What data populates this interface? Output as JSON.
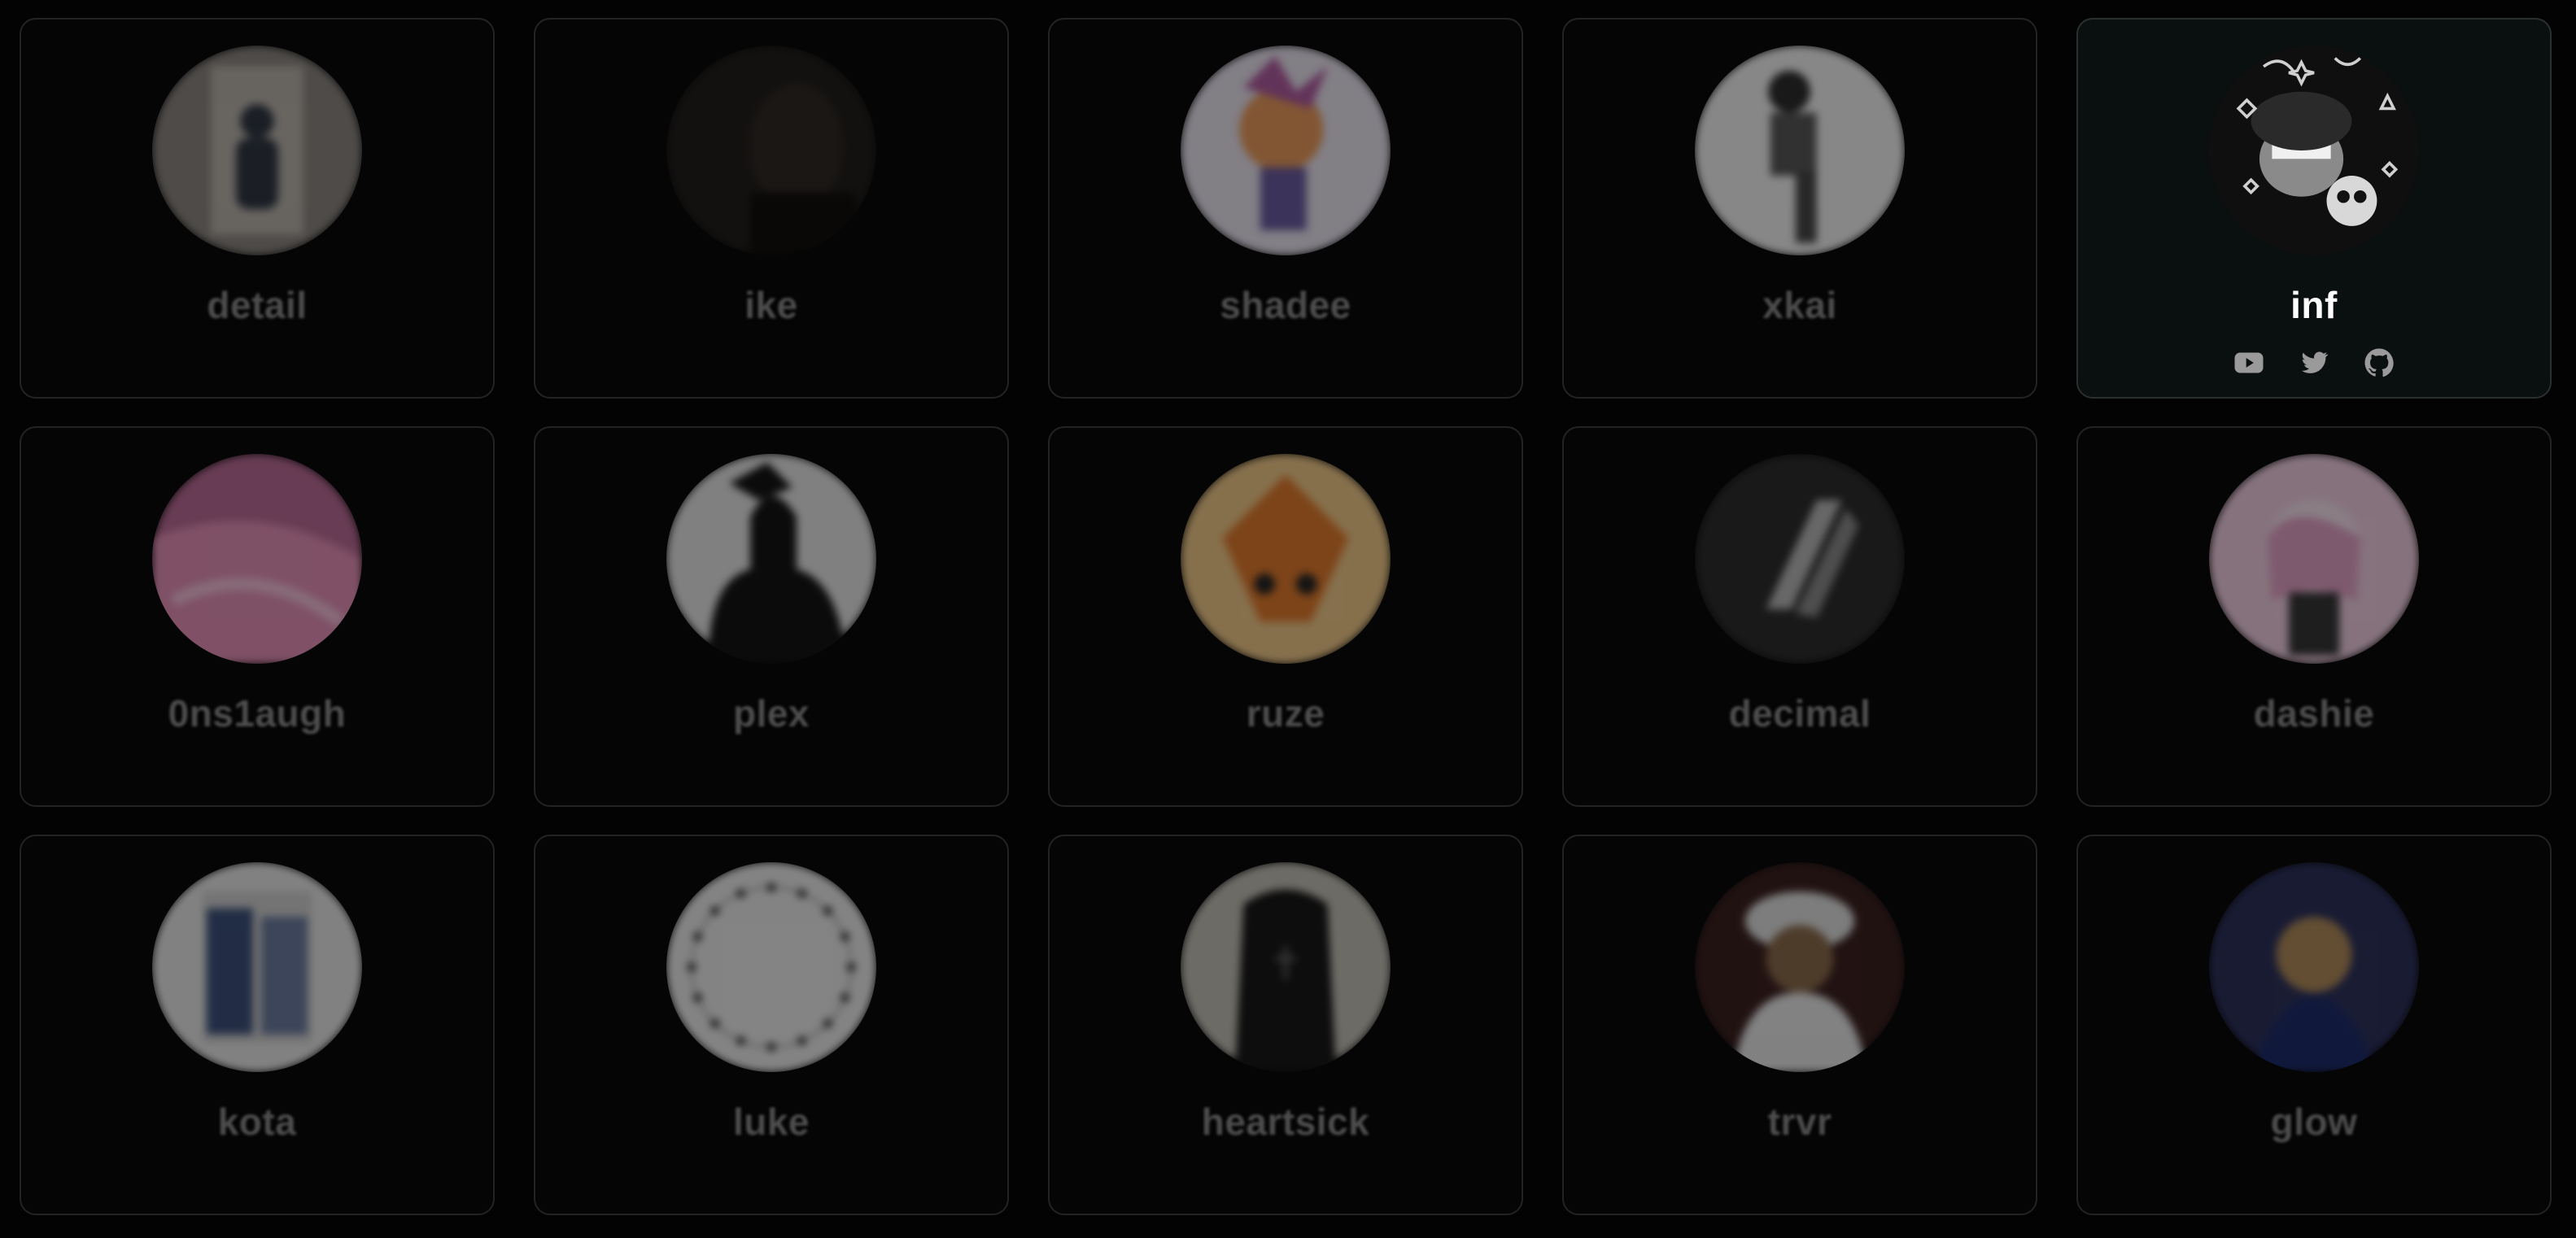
{
  "profiles": [
    {
      "name": "detail",
      "avatar": "mirror-selfie-photo",
      "bg": "#8a8580",
      "fg": "#2d3540"
    },
    {
      "name": "ike",
      "avatar": "dark-portrait-photo",
      "bg": "#1f1c1a",
      "fg": "#0d0b0a"
    },
    {
      "name": "shadee",
      "avatar": "anime-character-art",
      "bg": "#e9e3ef",
      "fg": "#b05aa0"
    },
    {
      "name": "xkai",
      "avatar": "sketch-figure-art",
      "bg": "#f2f2f2",
      "fg": "#2a2a2a"
    },
    {
      "name": "inf",
      "avatar": "doodle-character-art",
      "bg": "#1a1a1a",
      "fg": "#cfcfcf"
    },
    {
      "name": "0ns1augh",
      "avatar": "pink-abstract-art",
      "bg": "#b96a95",
      "fg": "#e48fb6"
    },
    {
      "name": "plex",
      "avatar": "black-silhouette-art",
      "bg": "#e5e5e5",
      "fg": "#111111"
    },
    {
      "name": "ruze",
      "avatar": "fox-character-art",
      "bg": "#f0c888",
      "fg": "#e0782a"
    },
    {
      "name": "decimal",
      "avatar": "logo-emblem",
      "bg": "#2a2a2a",
      "fg": "#b8b8b8"
    },
    {
      "name": "dashie",
      "avatar": "pink-anime-art",
      "bg": "#f0cde0",
      "fg": "#333333"
    },
    {
      "name": "kota",
      "avatar": "photo-collage",
      "bg": "#e8e8e8",
      "fg": "#3a4f7a"
    },
    {
      "name": "luke",
      "avatar": "dotted-ring-art",
      "bg": "#ececec",
      "fg": "#1a1a1a"
    },
    {
      "name": "heartsick",
      "avatar": "black-robe-photo",
      "bg": "#c4c0b6",
      "fg": "#141414"
    },
    {
      "name": "trvr",
      "avatar": "cap-character-art",
      "bg": "#3a1e1e",
      "fg": "#e8e8e8"
    },
    {
      "name": "glow",
      "avatar": "night-scene-art",
      "bg": "#2a2f5a",
      "fg": "#b08a5a"
    }
  ],
  "active_profile": {
    "name": "inf",
    "socials": [
      {
        "icon": "youtube-icon"
      },
      {
        "icon": "twitter-icon"
      },
      {
        "icon": "github-icon"
      }
    ]
  },
  "colors": {
    "page_bg": "#030303",
    "card_border": "#232323",
    "muted_name": "#4c4c4c",
    "active_name": "#ffffff",
    "icon_gray": "#9a9a9a"
  }
}
